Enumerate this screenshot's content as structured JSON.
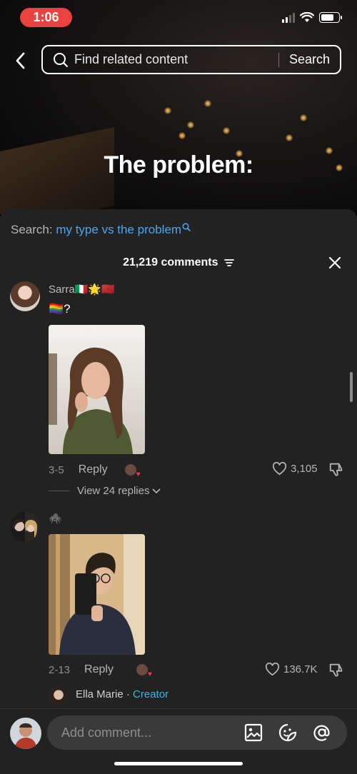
{
  "status": {
    "time": "1:06"
  },
  "header": {
    "search_placeholder": "Find related content",
    "search_button": "Search"
  },
  "video": {
    "title": "The problem:"
  },
  "comments_sheet": {
    "search_prefix": "Search:",
    "search_query": "my type vs the problem",
    "count_label": "21,219 comments"
  },
  "comments": [
    {
      "username": "Sarra🇮🇹🌟🇲🇦",
      "text": "🏳️‍🌈?",
      "date": "3-5",
      "reply_label": "Reply",
      "likes": "3,105",
      "view_replies": "View 24 replies"
    },
    {
      "username": "🕷️",
      "text": "",
      "date": "2-13",
      "reply_label": "Reply",
      "likes": "136.7K"
    }
  ],
  "creator_reply": {
    "name": "Ella Marie",
    "separator": "·",
    "tag": "Creator"
  },
  "composer": {
    "placeholder": "Add comment..."
  },
  "icons": {
    "back": "chevron-left-icon",
    "search": "search-icon",
    "filter": "filter-icon",
    "close": "close-icon",
    "heart": "heart-icon",
    "dislike": "thumbs-down-icon",
    "image": "image-icon",
    "emoji": "emoji-icon",
    "mention": "at-icon"
  },
  "colors": {
    "time_pill": "#ea4141",
    "link": "#4ea6f0",
    "creator": "#3fb4e0",
    "sheet": "#222222"
  }
}
